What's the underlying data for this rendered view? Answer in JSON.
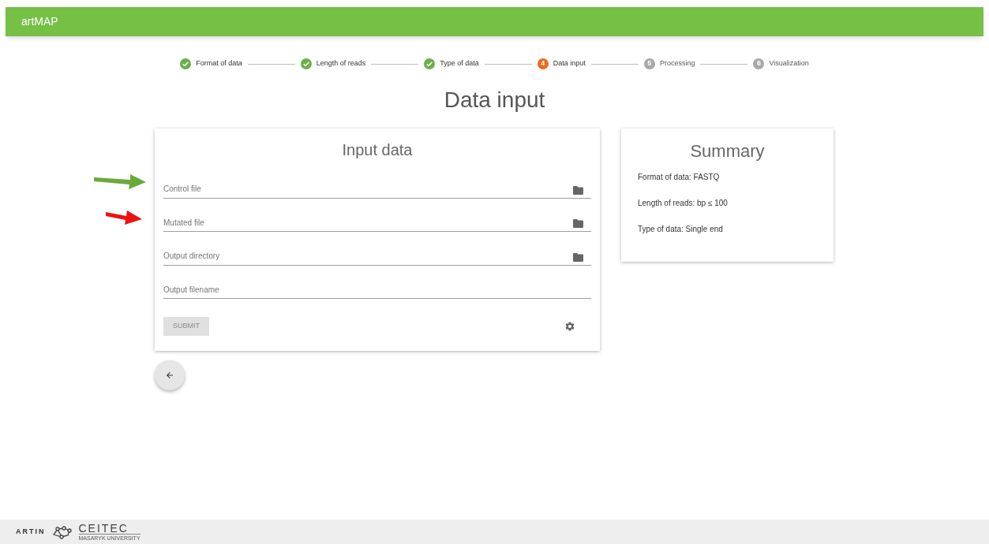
{
  "app_bar": {
    "title": "artMAP"
  },
  "stepper": [
    {
      "label": "Format of data",
      "kind": "done"
    },
    {
      "label": "Length of reads",
      "kind": "done"
    },
    {
      "label": "Type of data",
      "kind": "done"
    },
    {
      "label": "Data input",
      "kind": "active",
      "number": "4"
    },
    {
      "label": "Processing",
      "kind": "pending",
      "number": "5"
    },
    {
      "label": "Visualization",
      "kind": "pending",
      "number": "6"
    }
  ],
  "pointer_arrows": [
    {
      "color": "#6aaa3a"
    },
    {
      "color": "#ee1111"
    }
  ],
  "page_title": "Data input",
  "input_card": {
    "title": "Input data",
    "fields": [
      {
        "placeholder": "Control file",
        "browse": true
      },
      {
        "placeholder": "Mutated file",
        "browse": true
      },
      {
        "placeholder": "Output directory",
        "browse": true
      },
      {
        "placeholder": "Output filename",
        "browse": false
      }
    ],
    "submit": {
      "label": "SUBMIT",
      "disabled": true
    }
  },
  "summary_card": {
    "title": "Summary",
    "lines": [
      "Format of data: FASTQ",
      "Length of reads: bp ≤ 100",
      "Type of data: Single end"
    ]
  },
  "footer": {
    "logo_1": "ARTIN",
    "logo_2": "CEITEC",
    "logo_2_subtitle": "MASARYK UNIVERSITY"
  }
}
